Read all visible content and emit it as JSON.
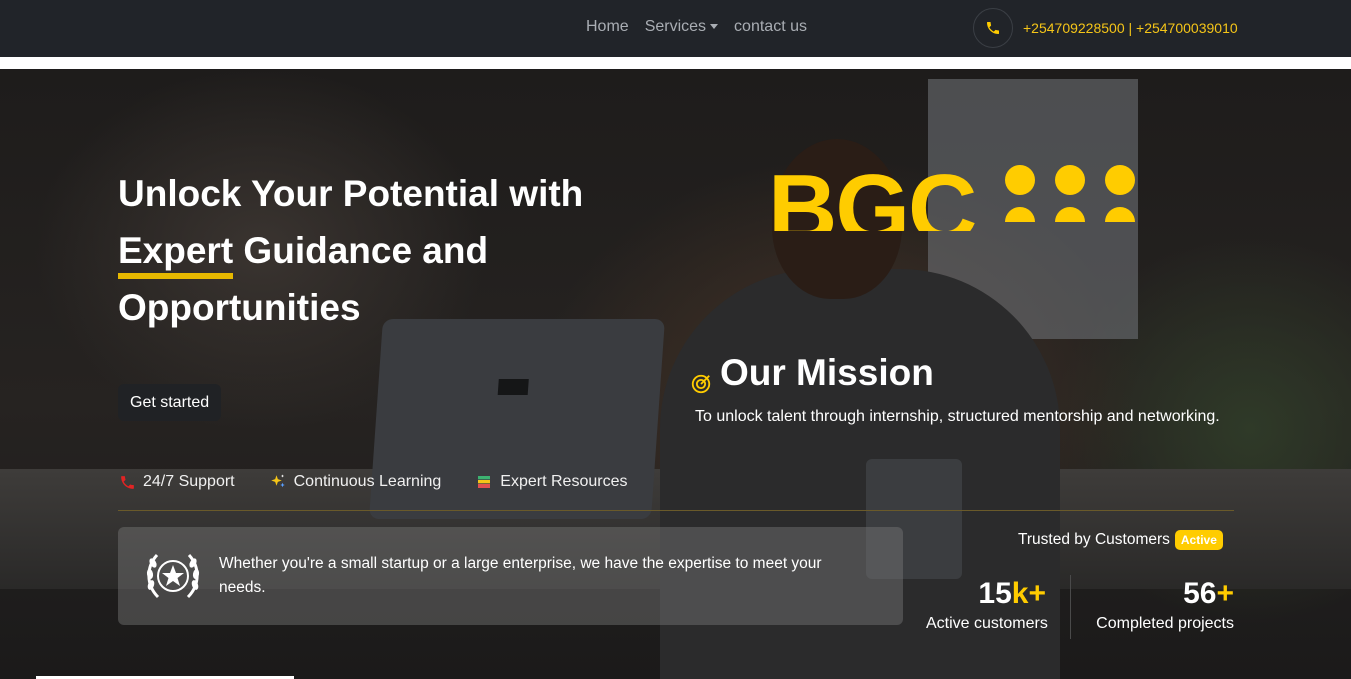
{
  "nav": {
    "links": [
      "Home",
      "Services",
      "contact us"
    ],
    "phones": "+254709228500 | +254700039010"
  },
  "hero": {
    "headline_1": "Unlock Your Potential with",
    "headline_2_underlined": "Expert",
    "headline_2_rest": " Guidance and",
    "headline_3": "Opportunities",
    "cta": "Get started",
    "features": [
      "24/7 Support",
      "Continuous Learning",
      "Expert Resources"
    ],
    "logo_text": "BGC",
    "mission_title": "Our Mission",
    "mission_text": "To unlock talent through internship, structured mentorship and networking.",
    "info_text": "Whether you're a small startup or a large enterprise, we have the expertise to meet your needs.",
    "trusted_label": "Trusted by Customers",
    "trusted_badge": "Active",
    "stats": [
      {
        "number": "15",
        "suffix": "k+",
        "label": "Active customers"
      },
      {
        "number": "56",
        "suffix": "+",
        "label": "Completed projects"
      }
    ]
  },
  "colors": {
    "accent": "#ffcc00",
    "navbar": "#212429"
  }
}
